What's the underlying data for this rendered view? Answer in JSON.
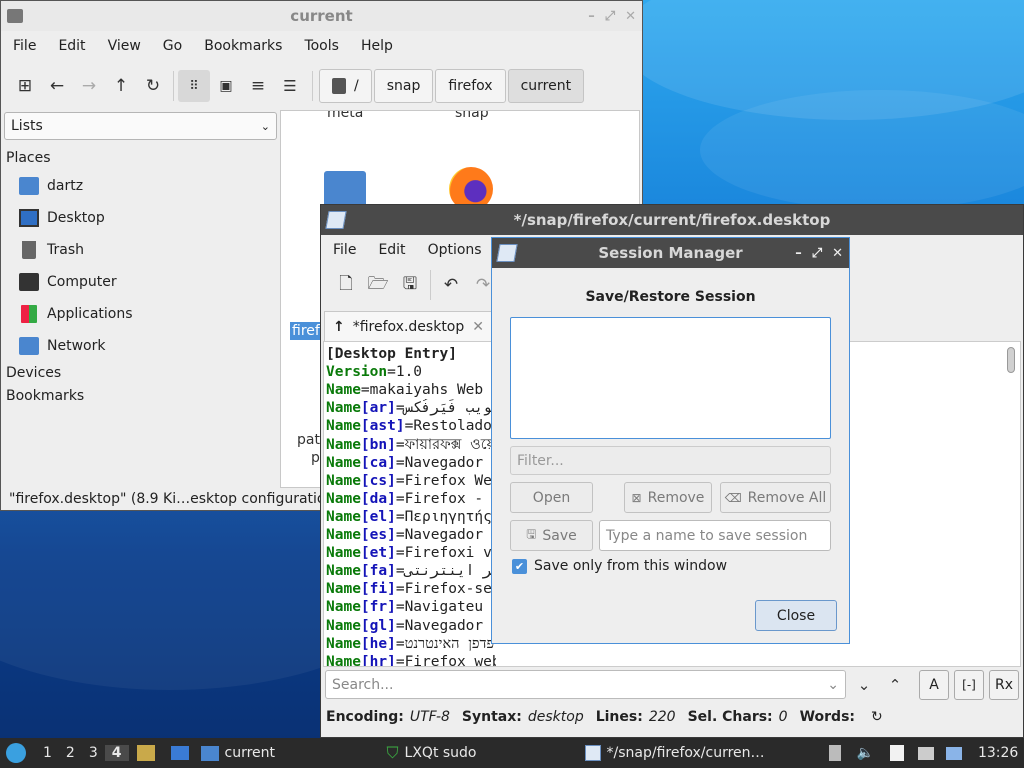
{
  "file_manager": {
    "title": "current",
    "menu": [
      "File",
      "Edit",
      "View",
      "Go",
      "Bookmarks",
      "Tools",
      "Help"
    ],
    "breadcrumbs": [
      "/",
      "snap",
      "firefox",
      "current"
    ],
    "view_select": "Lists",
    "sections": {
      "places": "Places",
      "devices": "Devices",
      "bookmarks": "Bookmarks"
    },
    "places": [
      {
        "label": "dartz",
        "icon": "home-folder-icon"
      },
      {
        "label": "Desktop",
        "icon": "desktop-icon"
      },
      {
        "label": "Trash",
        "icon": "trash-icon"
      },
      {
        "label": "Computer",
        "icon": "computer-icon"
      },
      {
        "label": "Applications",
        "icon": "applications-icon"
      },
      {
        "label": "Network",
        "icon": "network-icon"
      }
    ],
    "files": {
      "meta": "meta",
      "snap": "snap",
      "firefox_partial": "firef",
      "pate_partial": "pate",
      "p_partial": "p"
    },
    "status": "\"firefox.desktop\" (8.9 Ki…esktop configuratio"
  },
  "editor": {
    "title": "*/snap/firefox/current/firefox.desktop",
    "menu": [
      "File",
      "Edit",
      "Options"
    ],
    "tab_label": "*firefox.desktop",
    "lines": [
      {
        "key": "[Desktop Entry]",
        "lang": "",
        "val": ""
      },
      {
        "key": "Version",
        "lang": "",
        "val": "1.0"
      },
      {
        "key": "Name",
        "lang": "",
        "val": "makaiyahs Web"
      },
      {
        "key": "Name",
        "lang": "[ar]",
        "val": "متصفح الويب فَيَرفُكس"
      },
      {
        "key": "Name",
        "lang": "[ast]",
        "val": "Restolador"
      },
      {
        "key": "Name",
        "lang": "[bn]",
        "val": "ফায়ারফক্স ওয়েব"
      },
      {
        "key": "Name",
        "lang": "[ca]",
        "val": "Navegador"
      },
      {
        "key": "Name",
        "lang": "[cs]",
        "val": "Firefox We"
      },
      {
        "key": "Name",
        "lang": "[da]",
        "val": "Firefox -"
      },
      {
        "key": "Name",
        "lang": "[el]",
        "val": "Περιηγητής"
      },
      {
        "key": "Name",
        "lang": "[es]",
        "val": "Navegador"
      },
      {
        "key": "Name",
        "lang": "[et]",
        "val": "Firefoxi v"
      },
      {
        "key": "Name",
        "lang": "[fa]",
        "val": "مرورگر اینترنتی"
      },
      {
        "key": "Name",
        "lang": "[fi]",
        "val": "Firefox-se"
      },
      {
        "key": "Name",
        "lang": "[fr]",
        "val": "Navigateu"
      },
      {
        "key": "Name",
        "lang": "[gl]",
        "val": "Navegador"
      },
      {
        "key": "Name",
        "lang": "[he]",
        "val": "דפדפן האינטרנט Firefox"
      },
      {
        "key": "Name",
        "lang": "[hr]",
        "val": "Firefox web preglednik"
      }
    ],
    "search_placeholder": "Search...",
    "status": {
      "encoding_label": "Encoding:",
      "encoding": "UTF-8",
      "syntax_label": "Syntax:",
      "syntax": "desktop",
      "lines_label": "Lines:",
      "lines": "220",
      "selchars_label": "Sel. Chars:",
      "selchars": "0",
      "words_label": "Words:"
    },
    "toggles": [
      "A",
      "[-]",
      "Rx"
    ]
  },
  "session_manager": {
    "title": "Session Manager",
    "heading": "Save/Restore Session",
    "filter_placeholder": "Filter...",
    "open_label": "Open",
    "remove_label": "Remove",
    "remove_all_label": "Remove All",
    "save_label": "Save",
    "name_placeholder": "Type a name to save session",
    "checkbox_label": "Save only from this window",
    "checkbox_checked": true,
    "close_label": "Close"
  },
  "taskbar": {
    "desktops": [
      "1",
      "2",
      "3",
      "4"
    ],
    "active_desktop": "4",
    "tasks": [
      {
        "label": "current",
        "icon": "folder-icon"
      },
      {
        "label": "LXQt sudo",
        "icon": "shield-icon"
      },
      {
        "label": "*/snap/firefox/curren…",
        "icon": "text-editor-icon"
      }
    ],
    "clock": "13:26"
  },
  "colors": {
    "accent": "#4a90d9",
    "keyword": "#0a7a0a",
    "bracket": "#1414b8",
    "taskbar": "#2a2a2a"
  }
}
